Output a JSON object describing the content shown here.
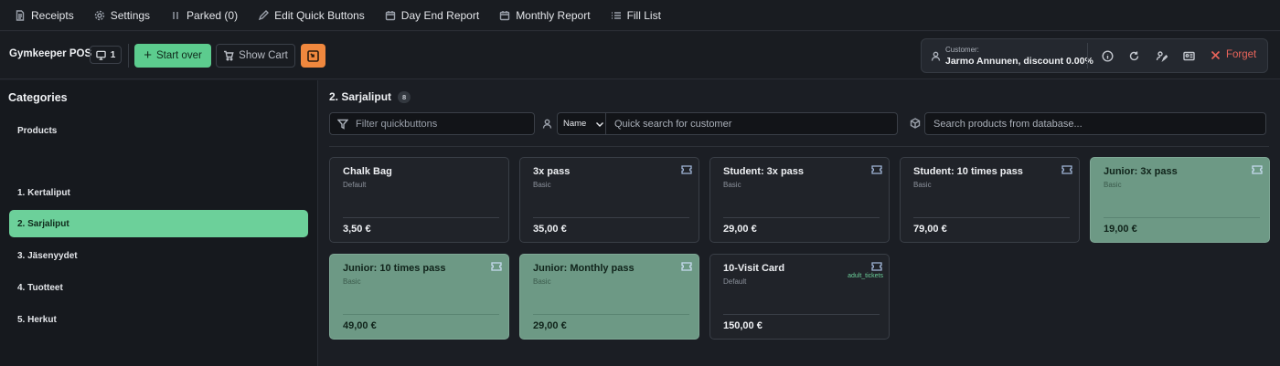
{
  "menu": {
    "items": [
      {
        "label": "Receipts",
        "icon": "receipt-icon"
      },
      {
        "label": "Settings",
        "icon": "gear-icon"
      },
      {
        "label": "Parked (0)",
        "icon": "pause-icon"
      },
      {
        "label": "Edit Quick Buttons",
        "icon": "pencil-icon"
      },
      {
        "label": "Day End Report",
        "icon": "calendar-icon"
      },
      {
        "label": "Monthly Report",
        "icon": "calendar-icon"
      },
      {
        "label": "Fill List",
        "icon": "list-icon"
      }
    ]
  },
  "toolbar": {
    "brand": "Gymkeeper POS",
    "register_count": "1",
    "start_over_label": "Start over",
    "show_cart_label": "Show Cart"
  },
  "customer": {
    "label": "Customer:",
    "name": "Jarmo Annunen, discount 0.00%",
    "forget_label": "Forget"
  },
  "sidebar": {
    "title": "Categories",
    "products_label": "Products",
    "items": [
      {
        "label": "1. Kertaliput",
        "active": false
      },
      {
        "label": "2. Sarjaliput",
        "active": true
      },
      {
        "label": "3. Jäsenyydet",
        "active": false
      },
      {
        "label": "4. Tuotteet",
        "active": false
      },
      {
        "label": "5. Herkut",
        "active": false
      }
    ]
  },
  "main": {
    "title": "2. Sarjaliput",
    "count": "8",
    "filter_placeholder": "Filter quickbuttons",
    "search_by": "Name",
    "customer_search_placeholder": "Quick search for customer",
    "db_search_placeholder": "Search products from database..."
  },
  "products": [
    {
      "name": "Chalk Bag",
      "group": "Default",
      "price": "3,50 €",
      "ticket": false,
      "highlight": false,
      "tag": ""
    },
    {
      "name": "3x pass",
      "group": "Basic",
      "price": "35,00 €",
      "ticket": true,
      "highlight": false,
      "tag": ""
    },
    {
      "name": "Student: 3x pass",
      "group": "Basic",
      "price": "29,00 €",
      "ticket": true,
      "highlight": false,
      "tag": ""
    },
    {
      "name": "Student: 10 times pass",
      "group": "Basic",
      "price": "79,00 €",
      "ticket": true,
      "highlight": false,
      "tag": ""
    },
    {
      "name": "Junior: 3x pass",
      "group": "Basic",
      "price": "19,00 €",
      "ticket": true,
      "highlight": true,
      "tag": ""
    },
    {
      "name": "Junior: 10 times pass",
      "group": "Basic",
      "price": "49,00 €",
      "ticket": true,
      "highlight": true,
      "tag": ""
    },
    {
      "name": "Junior: Monthly pass",
      "group": "Basic",
      "price": "29,00 €",
      "ticket": true,
      "highlight": true,
      "tag": ""
    },
    {
      "name": "10-Visit Card",
      "group": "Default",
      "price": "150,00 €",
      "ticket": true,
      "highlight": false,
      "tag": "adult_tickets"
    }
  ],
  "colors": {
    "accent_green": "#5ccc8e",
    "card_highlight": "#6d9985",
    "warning_orange": "#f0883e",
    "forget_red": "#e8645a"
  }
}
